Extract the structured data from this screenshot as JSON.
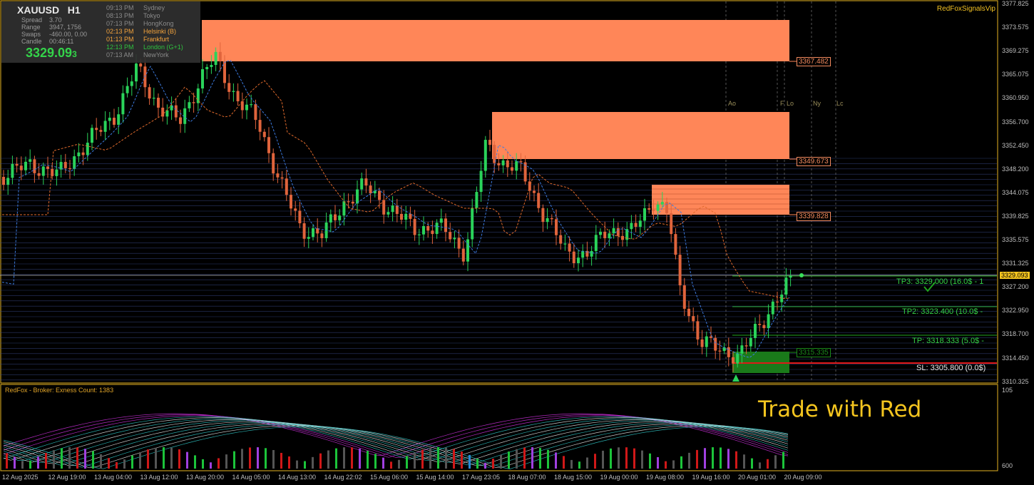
{
  "info": {
    "symbol": "XAUUSD",
    "timeframe": "H1",
    "rows": [
      {
        "label": "Spread",
        "value": "3.70"
      },
      {
        "label": "Range",
        "value": "3947, 1756"
      },
      {
        "label": "Swaps",
        "value": "-460.00, 0.00"
      },
      {
        "label": "Candle",
        "value": "00:46:11"
      }
    ],
    "price_main": "3329.09",
    "price_last_digit": "3",
    "sessions": [
      {
        "time": "09:13 PM",
        "city": "Sydney",
        "active": false
      },
      {
        "time": "08:13 PM",
        "city": "Tokyo",
        "active": false
      },
      {
        "time": "07:13 PM",
        "city": "HongKong",
        "active": false
      },
      {
        "time": "02:13 PM",
        "city": "Helsinki (B)",
        "active": true,
        "color": "#f2a23c"
      },
      {
        "time": "01:13 PM",
        "city": "Frankfurt",
        "active": true,
        "color": "#f2a23c"
      },
      {
        "time": "12:13 PM",
        "city": "London (G+1)",
        "active": true,
        "color": "#2fc23f"
      },
      {
        "time": "07:13 AM",
        "city": "NewYork",
        "active": false
      }
    ]
  },
  "brand": "RedFoxSignalsVip",
  "trade_text": "Trade with Red",
  "sub_window_label": "RedFox - Broker: Exness   Count: 1383",
  "current_price_label": "3329.093",
  "zones": [
    {
      "label": "3367.482"
    },
    {
      "label": "3349.673"
    },
    {
      "label": "3339.828"
    },
    {
      "label": "3315.335"
    }
  ],
  "targets": {
    "tp3": "TP3: 3329.000 (16.0$ - 1",
    "tp2": "TP2: 3323.400 (10.0$ -",
    "tp1": "TP: 3318.333 (5.0$ -",
    "sl": "SL: 3305.800 (0.0$)"
  },
  "session_markers": [
    "Ao",
    "F",
    "Lo",
    "Ny",
    "Lc"
  ],
  "y_axis": [
    "3377.825",
    "3373.575",
    "3369.275",
    "3365.075",
    "3360.950",
    "3356.700",
    "3352.450",
    "3348.200",
    "3344.075",
    "3339.825",
    "3335.575",
    "3331.325",
    "3327.200",
    "3322.950",
    "3318.700",
    "3314.450",
    "3310.325"
  ],
  "sub_y_axis": [
    "105",
    "600"
  ],
  "x_axis": [
    "12 Aug 2025",
    "12 Aug 19:00",
    "13 Aug 04:00",
    "13 Aug 12:00",
    "13 Aug 20:00",
    "14 Aug 05:00",
    "14 Aug 13:00",
    "14 Aug 22:02",
    "15 Aug 06:00",
    "15 Aug 14:00",
    "17 Aug 23:05",
    "18 Aug 07:00",
    "18 Aug 15:00",
    "19 Aug 00:00",
    "19 Aug 08:00",
    "19 Aug 16:00",
    "20 Aug 01:00",
    "20 Aug 09:00"
  ],
  "colors": {
    "bull": "#2ad35a",
    "bear": "#e0643c",
    "zone": "#ff8658",
    "tp_line": "#1fa31f",
    "sl_line": "#e01818",
    "panel_border": "#e6b422",
    "accent": "#f4c51f"
  }
}
